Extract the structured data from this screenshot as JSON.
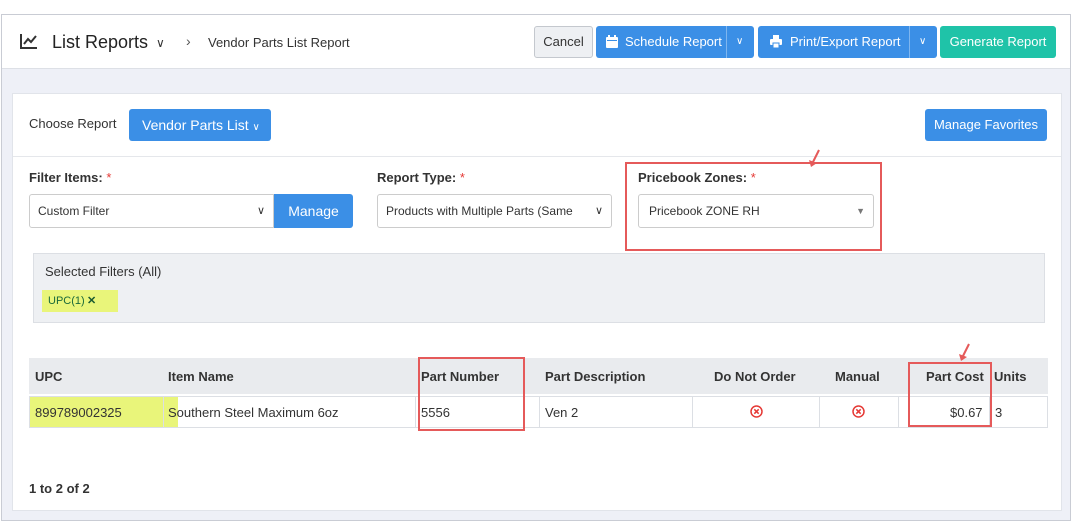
{
  "header": {
    "title": "List Reports",
    "breadcrumb_current": "Vendor Parts List Report",
    "cancel_label": "Cancel",
    "schedule_label": "Schedule Report",
    "print_label": "Print/Export Report",
    "generate_label": "Generate Report"
  },
  "panel": {
    "choose_label": "Choose Report",
    "report_selected": "Vendor Parts List",
    "manage_favorites": "Manage Favorites",
    "filter_items_label": "Filter Items:",
    "filter_items_value": "Custom Filter",
    "manage_label": "Manage",
    "report_type_label": "Report Type:",
    "report_type_value": "Products with Multiple Parts (Same",
    "pricebook_label": "Pricebook Zones:",
    "pricebook_value": "Pricebook ZONE RH",
    "required_mark": "*",
    "selected_filters_title": "Selected Filters (All)",
    "filter_chip": "UPC(1)"
  },
  "table": {
    "columns": [
      "UPC",
      "Item Name",
      "Part Number",
      "Part Description",
      "Do Not Order",
      "Manual",
      "Part Cost",
      "Units"
    ],
    "rows": [
      {
        "upc": "899789002325",
        "item_name": "Southern Steel Maximum 6oz",
        "part_number": "5556",
        "part_description": "Ven 2",
        "part_cost": "$0.67",
        "units": "3"
      }
    ]
  },
  "pager": {
    "text": "1 to 2 of 2"
  },
  "colors": {
    "primary": "#3b8fe6",
    "generate": "#1fc3a8",
    "highlight": "#e9f57a",
    "annotation": "#e55a5a",
    "danger": "#e53935"
  }
}
